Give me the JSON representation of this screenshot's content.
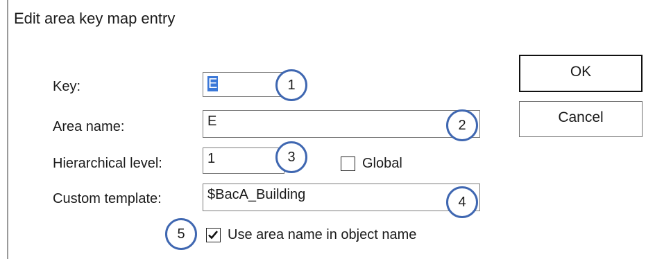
{
  "dialog": {
    "title": "Edit area key map entry",
    "key_label": "Key:",
    "key_value": "E",
    "area_name_label": "Area name:",
    "area_name_value": "E",
    "hier_label": "Hierarchical level:",
    "hier_value": "1",
    "global_label": "Global",
    "global_checked": false,
    "template_label": "Custom template:",
    "template_value": "$BacA_Building",
    "use_area_label": "Use area name in object name",
    "use_area_checked": true
  },
  "buttons": {
    "ok": "OK",
    "cancel": "Cancel"
  },
  "callouts": [
    "1",
    "2",
    "3",
    "4",
    "5"
  ],
  "colors": {
    "callout_ring": "#3f67b1",
    "selection": "#3b78d8"
  }
}
